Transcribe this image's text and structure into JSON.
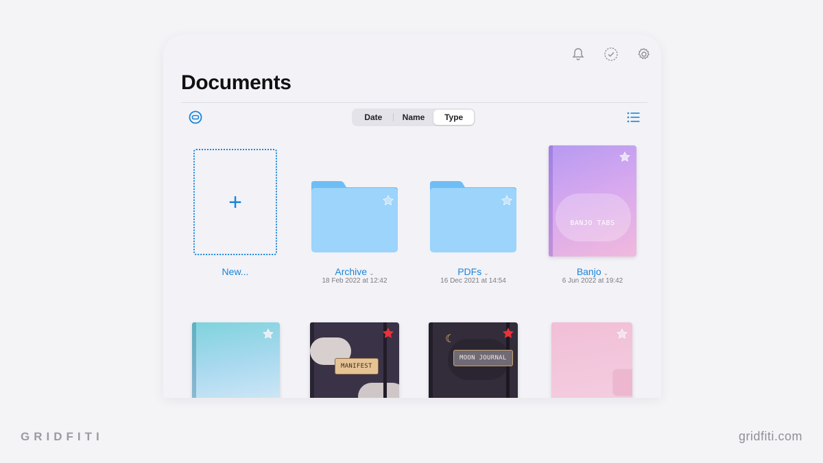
{
  "header": {
    "title": "Documents"
  },
  "sort": {
    "options": [
      "Date",
      "Name",
      "Type"
    ],
    "selected": "Type"
  },
  "items": [
    {
      "label": "New..."
    },
    {
      "label": "Archive",
      "date": "18 Feb 2022 at 12:42"
    },
    {
      "label": "PDFs",
      "date": "16 Dec 2021 at 14:54"
    },
    {
      "label": "Banjo",
      "date": "6 Jun 2022 at 19:42",
      "cover_text": "BANJO TABS"
    }
  ],
  "second_row": [
    {
      "cover": "teal-clouds"
    },
    {
      "cover_text": "MANIFEST",
      "favorite": true
    },
    {
      "cover_text": "MOON JOURNAL",
      "favorite": true
    },
    {
      "cover": "pink"
    }
  ],
  "branding": {
    "left": "GRIDFITI",
    "right": "gridfiti.com"
  },
  "colors": {
    "accent": "#1a84d8",
    "folder": "#9cd4fb",
    "favorite_star": "#e8323a"
  }
}
